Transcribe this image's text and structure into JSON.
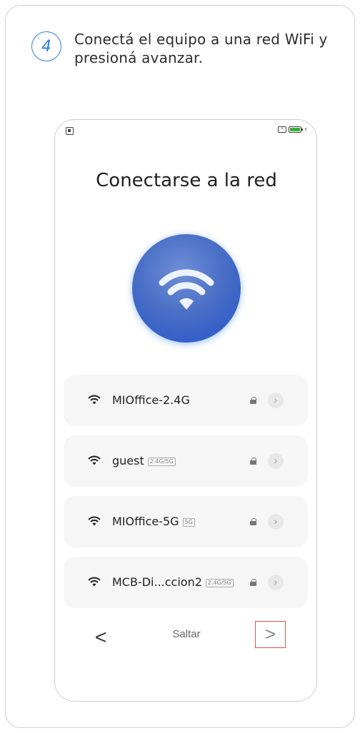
{
  "instruction": {
    "step_number": "4",
    "text": "Conectá el equipo a una red WiFi y presioná avanzar."
  },
  "phone": {
    "title": "Conectarse a la red",
    "networks": [
      {
        "name": "MIOffice-2.4G",
        "badge": ""
      },
      {
        "name": "guest",
        "badge": "2.4G/5G"
      },
      {
        "name": "MIOffice-5G",
        "badge": "5G"
      },
      {
        "name": "MCB-Di...ccion2",
        "badge": "2.4G/5G"
      }
    ],
    "nav": {
      "back": "<",
      "skip": "Saltar",
      "next": ">"
    }
  },
  "colors": {
    "accent": "#2f7fe0",
    "highlight": "#d9534f"
  }
}
